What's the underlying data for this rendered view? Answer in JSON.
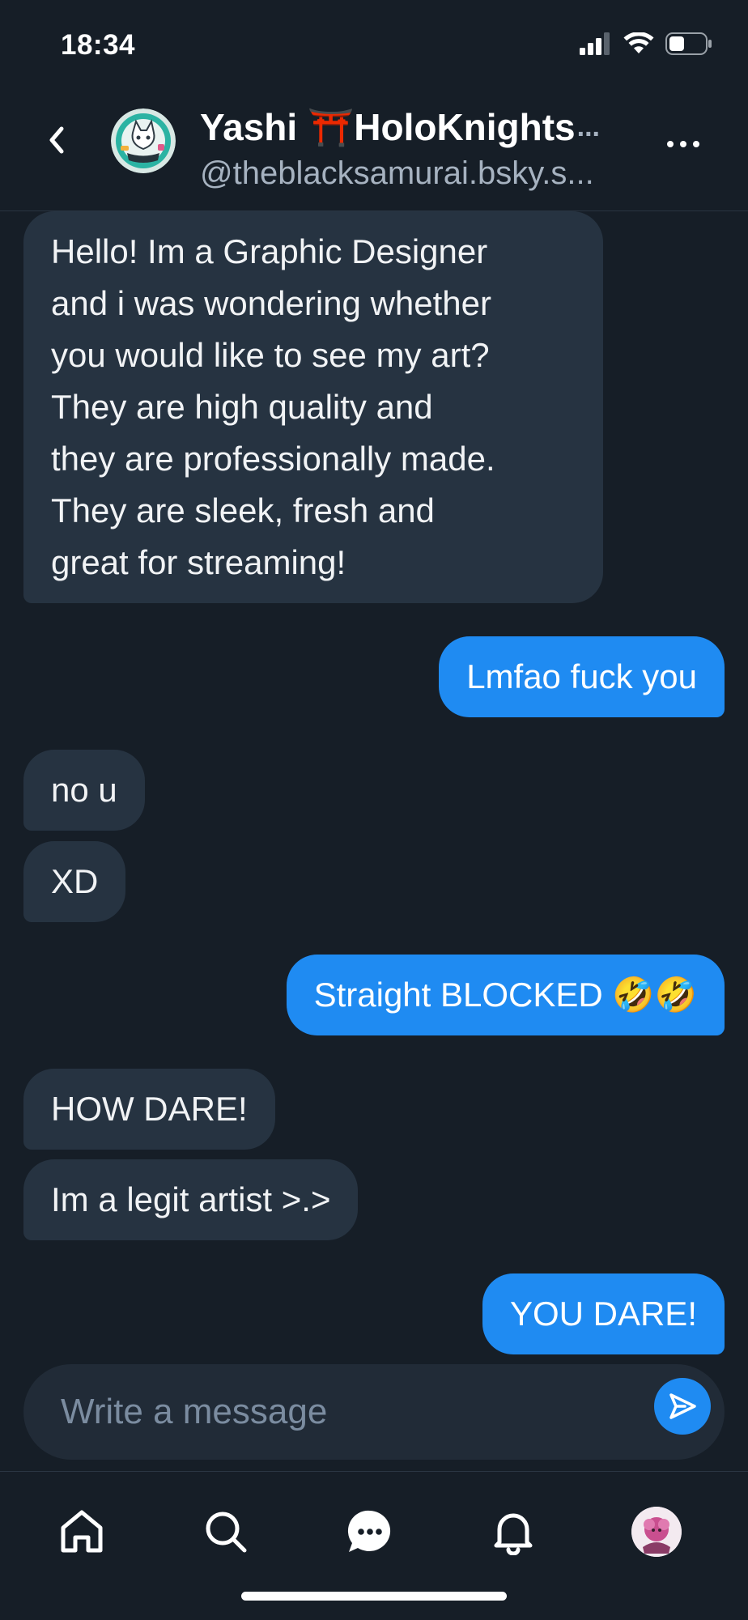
{
  "status_bar": {
    "time": "18:34"
  },
  "header": {
    "name": "Yashi ⛩️HoloKnights",
    "name_overflow": "...",
    "handle": "@theblacksamurai.bsky.s..."
  },
  "messages": [
    {
      "direction": "incoming",
      "lines": [
        "Hello! Im a Graphic Designer",
        "and i was wondering whether",
        "you would like to see my art?",
        "They are high quality and",
        "they are professionally made.",
        "They are sleek, fresh and",
        "great for streaming!"
      ]
    },
    {
      "direction": "outgoing",
      "lines": [
        "Lmfao fuck you"
      ]
    },
    {
      "direction": "incoming",
      "lines": [
        "no u"
      ]
    },
    {
      "direction": "incoming",
      "lines": [
        "XD"
      ]
    },
    {
      "direction": "outgoing",
      "lines": [
        "Straight BLOCKED 🤣🤣"
      ]
    },
    {
      "direction": "incoming",
      "lines": [
        "HOW DARE!"
      ]
    },
    {
      "direction": "incoming",
      "lines": [
        "Im a legit artist >.>"
      ]
    },
    {
      "direction": "outgoing",
      "lines": [
        "YOU DARE!"
      ]
    }
  ],
  "composer": {
    "placeholder": "Write a message",
    "value": ""
  },
  "nav": {
    "items": [
      {
        "icon": "home-icon"
      },
      {
        "icon": "search-icon"
      },
      {
        "icon": "chat-icon"
      },
      {
        "icon": "bell-icon"
      },
      {
        "icon": "profile-avatar"
      }
    ]
  },
  "colors": {
    "background": "#161e27",
    "incoming_bubble": "#263341",
    "outgoing_bubble": "#1f8bf2",
    "accent": "#1f8bf2"
  }
}
